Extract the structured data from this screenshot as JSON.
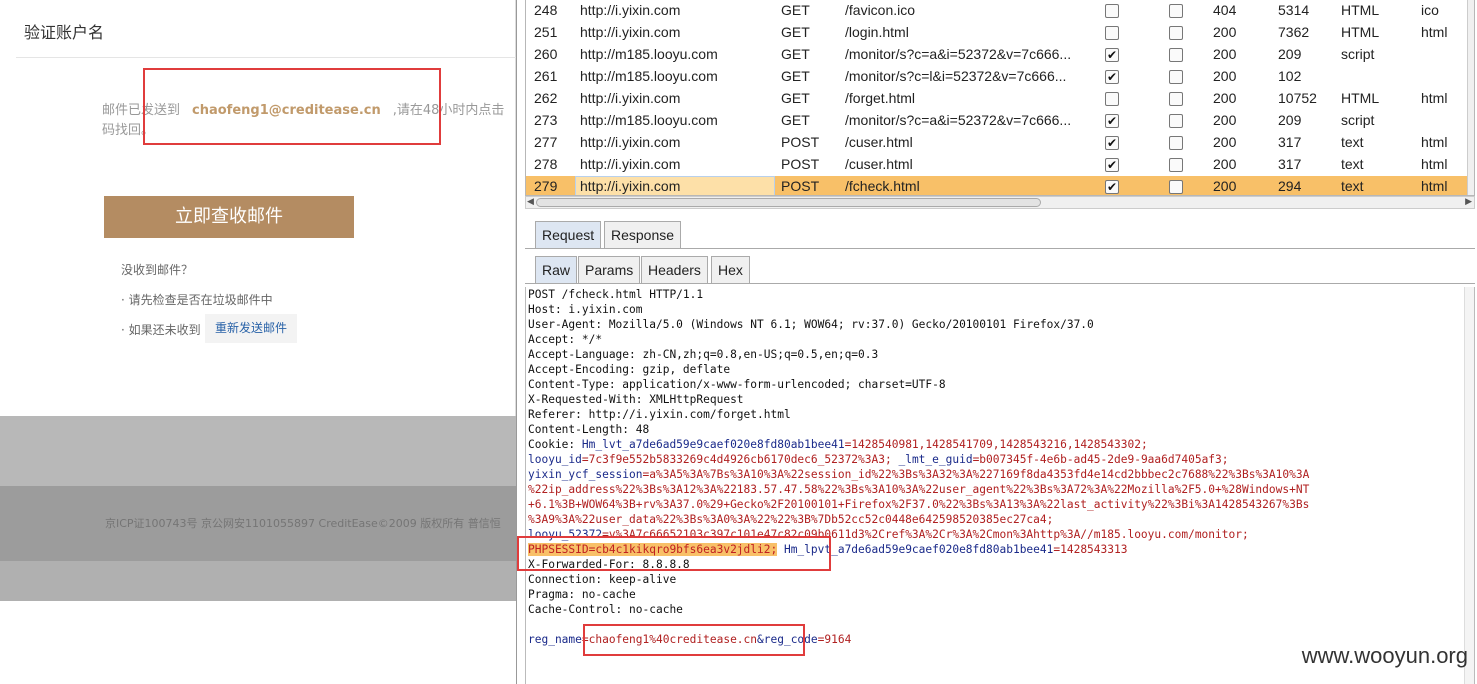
{
  "web": {
    "dialog_title": "验证账户名",
    "msg_prefix": "邮件已发送到",
    "msg_email": "chaofeng1@creditease.cn",
    "msg_suffix": ",请在48小时内点击",
    "msg_line2": "码找回。",
    "check_mail_button": "立即查收邮件",
    "no_mail": "没收到邮件？",
    "tip_spam": "· 请先检查是否在垃圾邮件中",
    "tip_resend_prefix": "· 如果还未收到",
    "resend_button": "重新发送邮件",
    "footer": "京ICP证100743号 京公网安1101055897 CreditEase©2009 版权所有 普信恒"
  },
  "history": {
    "rows": [
      {
        "num": "248",
        "host": "http://i.yixin.com",
        "method": "GET",
        "url": "/favicon.ico",
        "params": false,
        "edited": false,
        "status": "404",
        "length": "5314",
        "mime": "HTML",
        "ext": "ico"
      },
      {
        "num": "251",
        "host": "http://i.yixin.com",
        "method": "GET",
        "url": "/login.html",
        "params": false,
        "edited": false,
        "status": "200",
        "length": "7362",
        "mime": "HTML",
        "ext": "html"
      },
      {
        "num": "260",
        "host": "http://m185.looyu.com",
        "method": "GET",
        "url": "/monitor/s?c=a&i=52372&v=7c666...",
        "params": true,
        "edited": false,
        "status": "200",
        "length": "209",
        "mime": "script",
        "ext": ""
      },
      {
        "num": "261",
        "host": "http://m185.looyu.com",
        "method": "GET",
        "url": "/monitor/s?c=l&i=52372&v=7c666...",
        "params": true,
        "edited": false,
        "status": "200",
        "length": "102",
        "mime": "",
        "ext": ""
      },
      {
        "num": "262",
        "host": "http://i.yixin.com",
        "method": "GET",
        "url": "/forget.html",
        "params": false,
        "edited": false,
        "status": "200",
        "length": "10752",
        "mime": "HTML",
        "ext": "html"
      },
      {
        "num": "273",
        "host": "http://m185.looyu.com",
        "method": "GET",
        "url": "/monitor/s?c=a&i=52372&v=7c666...",
        "params": true,
        "edited": false,
        "status": "200",
        "length": "209",
        "mime": "script",
        "ext": ""
      },
      {
        "num": "277",
        "host": "http://i.yixin.com",
        "method": "POST",
        "url": "/cuser.html",
        "params": true,
        "edited": false,
        "status": "200",
        "length": "317",
        "mime": "text",
        "ext": "html"
      },
      {
        "num": "278",
        "host": "http://i.yixin.com",
        "method": "POST",
        "url": "/cuser.html",
        "params": true,
        "edited": false,
        "status": "200",
        "length": "317",
        "mime": "text",
        "ext": "html"
      },
      {
        "num": "279",
        "host": "http://i.yixin.com",
        "method": "POST",
        "url": "/fcheck.html",
        "params": true,
        "edited": false,
        "status": "200",
        "length": "294",
        "mime": "text",
        "ext": "html",
        "selected": true
      }
    ]
  },
  "tabs": {
    "request": "Request",
    "response": "Response",
    "raw": "Raw",
    "params": "Params",
    "headers": "Headers",
    "hex": "Hex"
  },
  "raw_request": {
    "l1": "POST /fcheck.html HTTP/1.1",
    "l2": "Host: i.yixin.com",
    "l3": "User-Agent: Mozilla/5.0 (Windows NT 6.1; WOW64; rv:37.0) Gecko/20100101 Firefox/37.0",
    "l4": "Accept: */*",
    "l5": "Accept-Language: zh-CN,zh;q=0.8,en-US;q=0.5,en;q=0.3",
    "l6": "Accept-Encoding: gzip, deflate",
    "l7": "Content-Type: application/x-www-form-urlencoded; charset=UTF-8",
    "l8": "X-Requested-With: XMLHttpRequest",
    "l9": "Referer: http://i.yixin.com/forget.html",
    "l10": "Content-Length: 48",
    "cookie_label": "Cookie: ",
    "c1k": "Hm_lvt_a7de6ad59e9caef020e8fd80ab1bee41",
    "c1v": "=1428540981,1428541709,1428543216,1428543302;",
    "c2k": "looyu_id",
    "c2v": "=7c3f9e552b5833269c4d4926cb6170dec6_52372%3A3;",
    "c3k": " _lmt_e_guid",
    "c3v": "=b007345f-4e6b-ad45-2de9-9aa6d7405af3;",
    "c4k": "yixin_ycf_session",
    "c4v": "=a%3A5%3A%7Bs%3A10%3A%22session_id%22%3Bs%3A32%3A%227169f8da4353fd4e14cd2bbbec2c7688%22%3Bs%3A10%3A",
    "c5": "%22ip_address%22%3Bs%3A12%3A%22183.57.47.58%22%3Bs%3A10%3A%22user_agent%22%3Bs%3A72%3A%22Mozilla%2F5.0+%28Windows+NT",
    "c6": "+6.1%3B+WOW64%3B+rv%3A37.0%29+Gecko%2F20100101+Firefox%2F37.0%22%3Bs%3A13%3A%22last_activity%22%3Bi%3A1428543267%3Bs",
    "c7": "%3A9%3A%22user_data%22%3Bs%3A0%3A%22%22%3B%7Db52cc52c0448e642598520385ec27ca4;",
    "c8k": "looyu_52372",
    "c8v": "=v%3A7c66652103c397c101e47c82c09b0611d3%2Cref%3A%2Cr%3A%2Cmon%3Ahttp%3A//m185.looyu.com/monitor;",
    "c9k": "PHPSESSID",
    "c9v": "=cb4c1kikqro9bfs6ea3v2jdli2;",
    "c10k": " Hm_lpvt_a7de6ad59e9caef020e8fd80ab1bee41",
    "c10v": "=1428543313",
    "l11": "X-Forwarded-For: 8.8.8.8",
    "l12": "Connection: keep-alive",
    "l13": "Pragma: no-cache",
    "l14": "Cache-Control: no-cache",
    "b1k": "reg_name",
    "b1v": "=chaofeng1%40creditease.cn",
    "b2k": "&reg_code",
    "b2v": "=9164"
  },
  "watermark": "www.wooyun.org",
  "colors": {
    "accent_button": "#b48c62",
    "selected_row": "#f8c068",
    "highlight_box": "#e03c3c"
  }
}
